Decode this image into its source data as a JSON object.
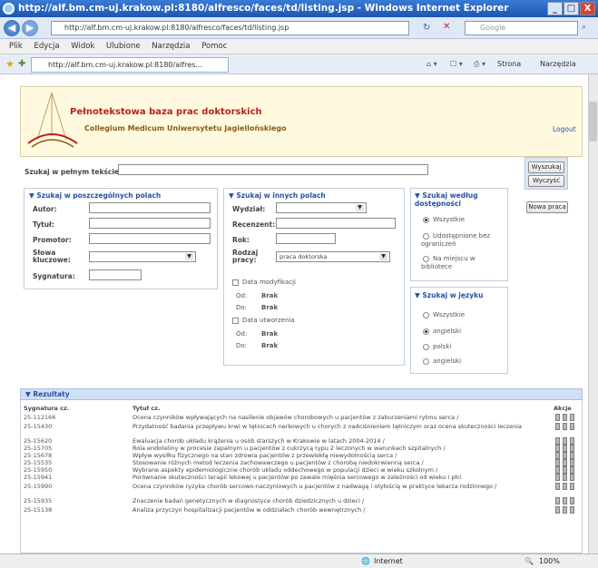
{
  "window": {
    "title": "http://alf.bm.cm-uj.krakow.pl:8180/alfresco/faces/td/listing.jsp - Windows Internet Explorer",
    "minimize": "_",
    "maximize": "□",
    "close": "X"
  },
  "address_bar": {
    "url": "http://alf.bm.cm-uj.krakow.pl:8180/alfresco/faces/td/listing.jsp",
    "search_placeholder": "Google"
  },
  "menu": [
    "Plik",
    "Edycja",
    "Widok",
    "Ulubione",
    "Narzędzia",
    "Pomoc"
  ],
  "tab": {
    "label": "http://alf.bm.cm-uj.krakow.pl:8180/alfres...",
    "tools": [
      "Strona",
      "Narzędzia"
    ]
  },
  "app": {
    "title": "Pełnotekstowa baza prac doktorskich",
    "subtitle": "Collegium Medicum Uniwersytetu Jagiellońskiego",
    "logout": "Logout"
  },
  "search": {
    "fulltext_label": "Szukaj w pełnym tekście:",
    "search_button": "Wyszukaj",
    "clear_button": "Wyczyść",
    "new_button": "Nowa praca"
  },
  "fields_group": {
    "title": "Szukaj w poszczególnych polach",
    "labels": [
      "Autor:",
      "Tytuł:",
      "Promotor:",
      "Słowa kluczowe:",
      "Sygnatura:"
    ]
  },
  "other_group": {
    "title": "Szukaj w innych polach",
    "labels": [
      "Wydział:",
      "Recenzent:",
      "Rok:",
      "Rodzaj pracy:"
    ],
    "type_value": "praca doktorska",
    "mod_date": "Data modyfikacji",
    "created_date": "Data utworzenia",
    "from": "Od:",
    "to": "Do:",
    "date_value": "Brak"
  },
  "access_group": {
    "title": "Szukaj według dostępności",
    "options": [
      "Wszystkie",
      "Udostępnione bez ograniczeń",
      "Na miejscu w bibliotece"
    ],
    "selected": 0
  },
  "lang_group": {
    "title": "Szukaj w języku",
    "options": [
      "Wszystkie",
      "angielski",
      "polski",
      "angielski"
    ],
    "selected": 1
  },
  "results": {
    "title": "Rezultaty",
    "headers": {
      "signature": "Sygnatura cz.",
      "title": "Tytuł cz.",
      "actions": "Akcje"
    },
    "rows": [
      {
        "sig": "25-112166",
        "title": "Ocena czynników wpływających na nasilenie objawów chorobowych u pacjentów z zaburzeniami rytmu serca /"
      },
      {
        "sig": "25-15430",
        "title": "Przydatność badania przepływu krwi w tętnicach nerkowych u chorych z nadciśnieniem tętniczym oraz ocena skuteczności leczenia"
      },
      {
        "sig": "25-15620",
        "title": "Ewaluacja chorób układu krążenia u osób starszych w Krakowie w latach 2004-2014 /"
      },
      {
        "sig": "25-15705",
        "title": "Rola endoteliny w procesie zapalnym u pacjentów z cukrzycą typu 2 leczonych w warunkach szpitalnych /"
      },
      {
        "sig": "25-15678",
        "title": "Wpływ wysiłku fizycznego na stan zdrowia pacjentów z przewlekłą niewydolnością serca /"
      },
      {
        "sig": "25-15535",
        "title": "Stosowanie różnych metod leczenia zachowawczego u pacjentów z chorobą niedokrwienną serca /"
      },
      {
        "sig": "25-15950",
        "title": "Wybrane aspekty epidemiologiczne chorób układu oddechowego w populacji dzieci w wieku szkolnym /"
      },
      {
        "sig": "25-15941",
        "title": "Porównanie skuteczności terapii lekowej u pacjentów po zawale mięśnia sercowego w zależności od wieku i płci"
      },
      {
        "sig": "25-15990",
        "title": "Ocena czynników ryzyka chorób sercowo-naczyniowych u pacjentów z nadwagą i otyłością w praktyce lekarza rodzinnego /"
      },
      {
        "sig": "25-15935",
        "title": "Znaczenie badań genetycznych w diagnostyce chorób dziedzicznych u dzieci /"
      },
      {
        "sig": "25-15138",
        "title": "Analiza przyczyn hospitalizacji pacjentów w oddziałach chorób wewnętrznych /"
      }
    ]
  },
  "status": {
    "zone": "Internet",
    "zoom": "100%"
  }
}
